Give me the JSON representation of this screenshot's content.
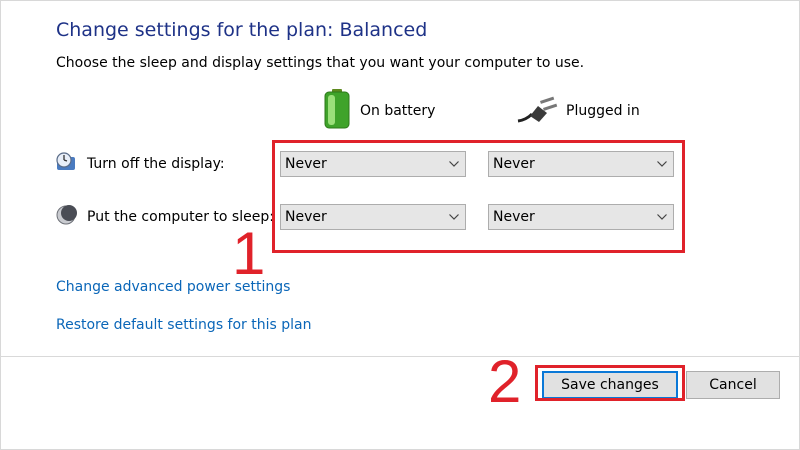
{
  "header": {
    "title": "Change settings for the plan: Balanced",
    "subtitle": "Choose the sleep and display settings that you want your computer to use."
  },
  "columns": {
    "battery": {
      "label": "On battery",
      "icon": "battery-icon"
    },
    "plugged": {
      "label": "Plugged in",
      "icon": "power-plug-icon"
    }
  },
  "rows": [
    {
      "label": "Turn off the display:",
      "icon": "display-timer-icon",
      "battery_value": "Never",
      "plugged_value": "Never"
    },
    {
      "label": "Put the computer to sleep:",
      "icon": "sleep-moon-icon",
      "battery_value": "Never",
      "plugged_value": "Never"
    }
  ],
  "links": {
    "advanced": "Change advanced power settings",
    "restore": "Restore default settings for this plan"
  },
  "buttons": {
    "save": "Save changes",
    "cancel": "Cancel"
  },
  "annotations": {
    "marker_1": "1",
    "marker_2": "2",
    "color": "#e0222a"
  },
  "colors": {
    "title": "#1e3287",
    "link": "#0a66b8",
    "primary_border": "#0a78d7"
  }
}
